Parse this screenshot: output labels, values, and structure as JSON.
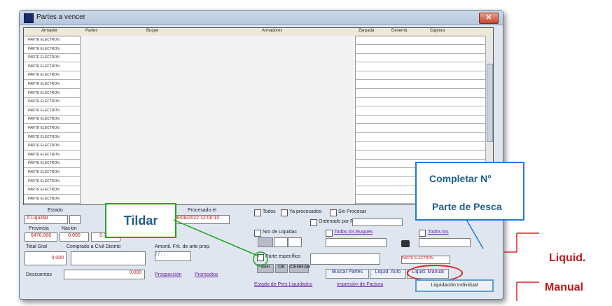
{
  "window": {
    "title": "Partes a vencer",
    "close_glyph": "✕"
  },
  "grid": {
    "columns": [
      "Armador",
      "Partes",
      "Buque",
      "Armadores",
      "Zarpada",
      "Desemb.",
      "Captura"
    ],
    "row_count": 19,
    "sample_cell": "PARTE ELECTRON"
  },
  "bottom": {
    "estado_label": "Estado",
    "estado_value": "A Liquidar",
    "procesado_label": "Procesado el",
    "procesado_value": "06/08/2022 12:00:10",
    "provincia_label": "Provincia",
    "nacion_label": "Nacion",
    "provincia_value": "6476.066",
    "nacion_value": "0.000",
    "third_value": "0.000",
    "total_label": "Total Gral",
    "comprado_label": "Comprado a Civil Distrito",
    "amort_label": "Amortil. Frk. de arte prop.",
    "total_value": "0.000",
    "date_placeholder": "/ /   : :",
    "descuentos_label": "Descuentos",
    "descuentos_value": "0.000",
    "prospeccion_link": "Prospección",
    "promedio_link": "Promedios",
    "todos_label": "Todos",
    "ya_procesados_label": "Ya procesados",
    "sin_procesar_label": "Sin Procesar",
    "ordenado_label": "Ordenado por Fecha",
    "nro_liquidac_label": "Nro de Liquidac",
    "todos_buques_label": "Todos los Buques",
    "todos_armadores_label": "Todos los",
    "parte_especifico_label": "Parte específico",
    "parte_field_value": "PARTE ELECTRON",
    "buscar_btn": "Buscar Partes",
    "liquid_auto_btn": "Liquid. Auto",
    "liquid_manual_btn": "Liquid. Manual",
    "estado_link": "Estado de Ptes Liquidados",
    "impresion_link": "Impresión de Factura",
    "liquidacion_btn": "Liquidación Individual",
    "small_btn_1": "GHI",
    "small_btn_2": "OK",
    "small_btn_3": "CERRAR"
  },
  "callouts": {
    "tildar": "Tildar",
    "completar_line1": "Completar   N°",
    "completar_line2": "Parte de Pesca",
    "liquid": "Liquid.",
    "manual": "Manual"
  }
}
